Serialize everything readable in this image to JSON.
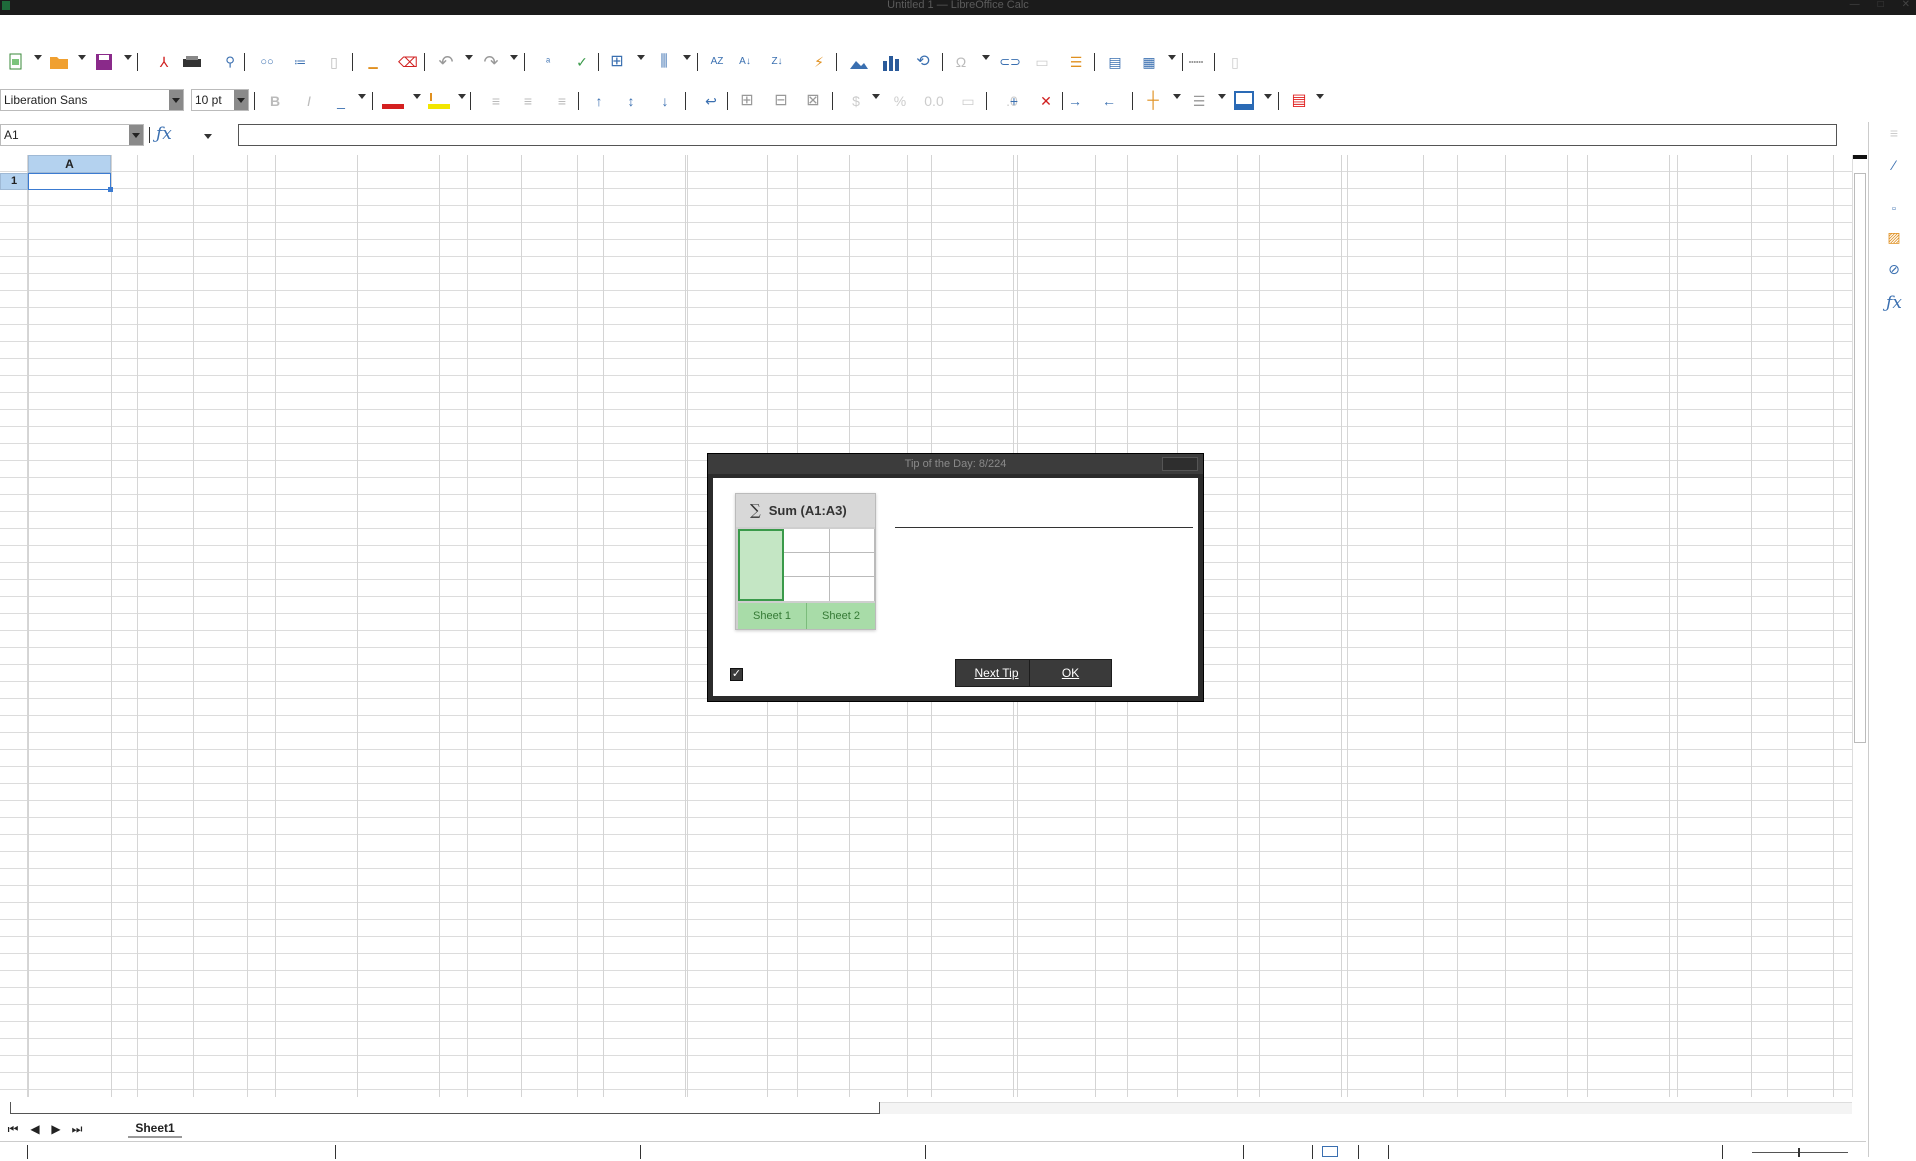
{
  "window": {
    "title": "Untitled 1 — LibreOffice Calc"
  },
  "font_toolbar": {
    "font_name": "Liberation Sans",
    "font_size": "10 pt",
    "font_color": "#d42020",
    "highlight_color": "#f2e600",
    "border_color": "#2a6ab5"
  },
  "formula_bar": {
    "cell_reference": "A1",
    "formula_value": ""
  },
  "grid": {
    "column_header_a": "A",
    "row_header_1": "1",
    "selection_color": "#b4d2ef"
  },
  "sheet_tabs": {
    "active": "Sheet1"
  },
  "dialog": {
    "title": "Tip of the Day: 8/224",
    "image": {
      "header_text": "Sum (A1:A3)",
      "tab1": "Sheet 1",
      "tab2": "Sheet 2"
    },
    "tip_text": "",
    "show_tips_checked": true,
    "next_tip_label": "Next Tip",
    "ok_label": "OK"
  }
}
